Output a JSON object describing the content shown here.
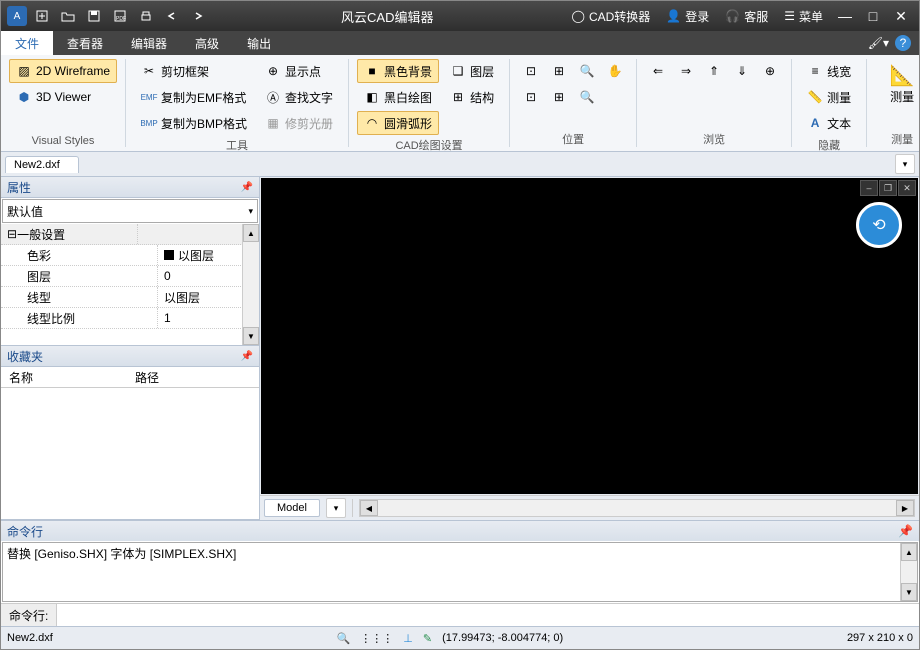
{
  "title": "风云CAD编辑器",
  "titlebar_right": {
    "converter": "CAD转换器",
    "login": "登录",
    "support": "客服",
    "menu": "菜单"
  },
  "menu": {
    "file": "文件",
    "viewer": "查看器",
    "editor": "编辑器",
    "advanced": "高级",
    "output": "输出"
  },
  "ribbon": {
    "visual_styles": {
      "label": "Visual Styles",
      "wireframe": "2D Wireframe",
      "viewer3d": "3D Viewer"
    },
    "tools": {
      "label": "工具",
      "clip_frame": "剪切框架",
      "copy_emf": "复制为EMF格式",
      "copy_bmp": "复制为BMP格式",
      "show_point": "显示点",
      "find_text": "查找文字",
      "trim_album": "修剪光册"
    },
    "cad_settings": {
      "label": "CAD绘图设置",
      "black_bg": "黑色背景",
      "bw_draw": "黑白绘图",
      "smooth_arc": "圆滑弧形",
      "layer": "图层",
      "structure": "结构"
    },
    "position": {
      "label": "位置"
    },
    "browse": {
      "label": "浏览"
    },
    "hide": {
      "label": "隐藏",
      "linewidth": "线宽",
      "measure": "测量",
      "text": "文本"
    },
    "measure": {
      "label": "测量"
    }
  },
  "file_tab": "New2.dxf",
  "props": {
    "title": "属性",
    "default": "默认值",
    "general": "一般设置",
    "rows": [
      {
        "k": "色彩",
        "v": "以图层",
        "sw": true
      },
      {
        "k": "图层",
        "v": "0"
      },
      {
        "k": "线型",
        "v": "以图层"
      },
      {
        "k": "线型比例",
        "v": "1"
      }
    ]
  },
  "fav": {
    "title": "收藏夹",
    "name": "名称",
    "path": "路径"
  },
  "canvas": {
    "model_tab": "Model"
  },
  "cmd": {
    "title": "命令行",
    "log": "替换 [Geniso.SHX] 字体为 [SIMPLEX.SHX]",
    "label": "命令行:"
  },
  "status": {
    "file": "New2.dxf",
    "coords": "(17.99473; -8.004774; 0)",
    "dims": "297 x 210 x 0"
  }
}
